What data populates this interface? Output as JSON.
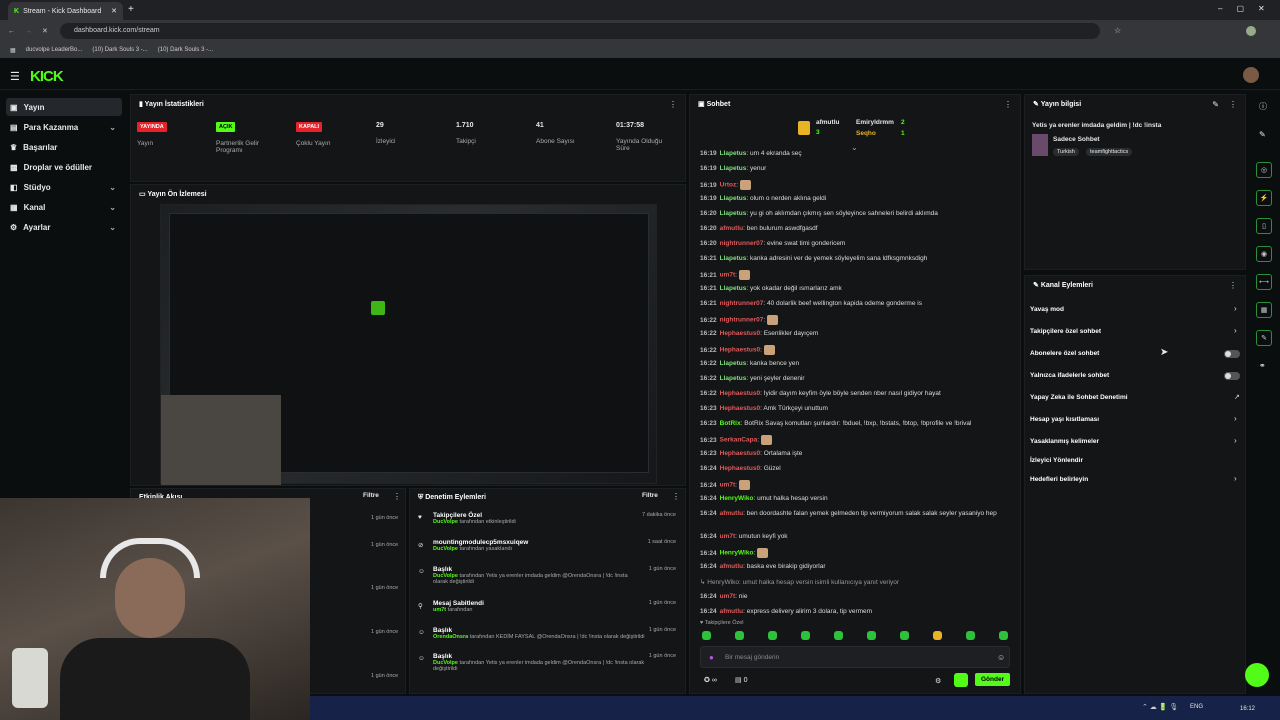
{
  "browser": {
    "tab_title": "Stream - Kick Dashboard",
    "url": "dashboard.kick.com/stream",
    "bookmarks": [
      "ducvolpe LeaderBo...",
      "(10) Dark Souls 3 -...",
      "(10) Dark Souls 3 -..."
    ]
  },
  "logo": "KICK",
  "sidebar": {
    "items": [
      {
        "label": "Yayın",
        "icon": "play-icon"
      },
      {
        "label": "Para Kazanma",
        "icon": "money-icon"
      },
      {
        "label": "Başarılar",
        "icon": "trophy-icon"
      },
      {
        "label": "Droplar ve ödüller",
        "icon": "gift-icon"
      },
      {
        "label": "Stüdyo",
        "icon": "studio-icon"
      },
      {
        "label": "Kanal",
        "icon": "channel-icon"
      },
      {
        "label": "Ayarlar",
        "icon": "gear-icon"
      }
    ]
  },
  "stats": {
    "title": "Yayın İstatistikleri",
    "items": [
      {
        "value": "YAYINDA",
        "label": "Yayın"
      },
      {
        "value": "AÇIK",
        "label": "Partnerlik Gelir Programı"
      },
      {
        "value": "KAPALI",
        "label": "Çoklu Yayın"
      },
      {
        "value": "29",
        "label": "İzleyici"
      },
      {
        "value": "1.710",
        "label": "Takipçi"
      },
      {
        "value": "41",
        "label": "Abone Sayısı"
      },
      {
        "value": "01:37:58",
        "label": "Yayında Olduğu Süre"
      }
    ]
  },
  "preview": {
    "title": "Yayın Ön İzlemesi"
  },
  "activity": {
    "title": "Etkinlik Akışı",
    "filter": "Filtre",
    "times": [
      "1 gün önce",
      "1 gün önce",
      "1 gün önce",
      "1 gün önce",
      "1 gün önce"
    ]
  },
  "moderation": {
    "title": "Denetim Eylemleri",
    "filter": "Filtre",
    "items": [
      {
        "title": "Takipçilere Özel",
        "by": "DucVolpe",
        "sub": "tarafından etkinleştirildi",
        "time": "7 dakika önce"
      },
      {
        "title": "mountingmodulecp5msxuiqew",
        "by": "DucVolpe",
        "sub": "tarafından yasaklandı",
        "time": "1 saat önce"
      },
      {
        "title": "Başlık",
        "by": "DucVolpe",
        "sub": "tarafından Yetis ya erenler imdada geldim @OrendaOnsra | !dc !insta olarak değiştirildi",
        "time": "1 gün önce"
      },
      {
        "title": "Mesaj Sabitlendi",
        "by": "um7t",
        "sub": "tarafından",
        "time": "1 gün önce"
      },
      {
        "title": "Başlık",
        "by": "OrendaOnsra",
        "sub": "tarafından KEDİM FAYSAL @OrendaOnsra | !dc !insta olarak değiştirildi",
        "time": "1 gün önce"
      },
      {
        "title": "Başlık",
        "by": "DucVolpe",
        "sub": "tarafından Yetis ya erenler imdada geldim @OrendaOnsra | !dc !insta olarak değiştirildi",
        "time": "1 gün önce"
      }
    ]
  },
  "chat": {
    "title": "Sohbet",
    "top_gifters": [
      {
        "name": "afmutlu",
        "count": "3"
      },
      {
        "name": "Emiryldrmm",
        "count": "2"
      },
      {
        "name": "Seqho",
        "count": "1"
      }
    ],
    "messages": [
      {
        "time": "16:19",
        "user": "Llapetus",
        "color": "#7fe07f",
        "text": "um 4 ekranda seç"
      },
      {
        "time": "16:19",
        "user": "Llapetus",
        "color": "#7fe07f",
        "text": "yenur"
      },
      {
        "time": "16:19",
        "user": "Urtoz",
        "color": "#e05a5a",
        "text": ""
      },
      {
        "time": "16:19",
        "user": "Llapetus",
        "color": "#7fe07f",
        "text": "olum o nerden aklına geldi"
      },
      {
        "time": "16:20",
        "user": "Llapetus",
        "color": "#7fe07f",
        "text": "yu gi oh aklımdan çıkmış sen söyleyince sahneleri belirdi aklımda"
      },
      {
        "time": "16:20",
        "user": "afmutlu",
        "color": "#e05a5a",
        "text": "ben bulurum aswdfgasdf"
      },
      {
        "time": "16:20",
        "user": "nightrunner07",
        "color": "#e05a5a",
        "text": "evine swat timi gondericem"
      },
      {
        "time": "16:21",
        "user": "Llapetus",
        "color": "#7fe07f",
        "text": "kanka adresini ver de yemek söyleyelim sana ldfksgmnksdigh"
      },
      {
        "time": "16:21",
        "user": "um7t",
        "color": "#e05a5a",
        "text": ""
      },
      {
        "time": "16:21",
        "user": "Llapetus",
        "color": "#7fe07f",
        "text": "yok okadar değil ısmarlarız amk"
      },
      {
        "time": "16:21",
        "user": "nightrunner07",
        "color": "#e05a5a",
        "text": "40 dolarlik beef wellington kapida odeme gonderme is"
      },
      {
        "time": "16:22",
        "user": "nightrunner07",
        "color": "#e05a5a",
        "text": ""
      },
      {
        "time": "16:22",
        "user": "Hephaestus0",
        "color": "#e05a5a",
        "text": "Esenlikler dayıçem"
      },
      {
        "time": "16:22",
        "user": "Hephaestus0",
        "color": "#e05a5a",
        "text": ""
      },
      {
        "time": "16:22",
        "user": "Llapetus",
        "color": "#7fe07f",
        "text": "kanka bence yen"
      },
      {
        "time": "16:22",
        "user": "Llapetus",
        "color": "#7fe07f",
        "text": "yeni şeyler denenir"
      },
      {
        "time": "16:22",
        "user": "Hephaestus0",
        "color": "#e05a5a",
        "text": "İyidir dayım keyfim öyle böyle senden nber nasıl gidiyor hayat"
      },
      {
        "time": "16:23",
        "user": "Hephaestus0",
        "color": "#e05a5a",
        "text": "Amk Türkçeyi unuttum"
      },
      {
        "time": "16:23",
        "user": "BotRix",
        "color": "#53fc18",
        "text": "BotRix Savaş komutları şunlardır: !bduel, !bxp, !bstats, !btop, !bprofile ve !brival"
      },
      {
        "time": "16:23",
        "user": "SerkanCapa",
        "color": "#e05a5a",
        "text": ""
      },
      {
        "time": "16:23",
        "user": "Hephaestus0",
        "color": "#e05a5a",
        "text": "Ortalama işte"
      },
      {
        "time": "16:24",
        "user": "Hephaestus0",
        "color": "#e05a5a",
        "text": "Güzel"
      },
      {
        "time": "16:24",
        "user": "um7t",
        "color": "#e05a5a",
        "text": ""
      },
      {
        "time": "16:24",
        "user": "HenryWiko",
        "color": "#53fc18",
        "text": "umut halka hesap versin"
      },
      {
        "time": "16:24",
        "user": "afmutlu",
        "color": "#e05a5a",
        "text": "ben doordashte falan yemek gelmeden tip vermiyorum salak salak seyler yasaniyo hep"
      },
      {
        "time": "16:24",
        "user": "um7t",
        "color": "#e05a5a",
        "text": "umutun keyfi yok"
      },
      {
        "time": "16:24",
        "user": "HenryWiko",
        "color": "#53fc18",
        "text": ""
      },
      {
        "time": "16:24",
        "user": "afmutlu",
        "color": "#e05a5a",
        "text": "baska eve birakip gidiyorlar"
      },
      {
        "time": "",
        "user": "",
        "color": "#999",
        "text": "↳ HenryWiko: umut halka hesap versin isimli kullanıcıya yanıt veriyor"
      },
      {
        "time": "16:24",
        "user": "um7t",
        "color": "#e05a5a",
        "text": "nie"
      },
      {
        "time": "16:24",
        "user": "afmutlu",
        "color": "#e05a5a",
        "text": "express delivery alirim 3 dolara, tip vermem"
      }
    ],
    "mode_label": "Takipçilere Özel",
    "input_placeholder": "Bir mesaj gönderin",
    "send_label": "Gönder",
    "viewers_count": "0",
    "infinity": "∞"
  },
  "stream_info": {
    "title": "Yayın bilgisi",
    "stream_title": "Yetis ya erenler imdada geldim | !dc !insta",
    "category": "Sadece Sohbet",
    "tags": [
      "Turkish",
      "teamfighttactics"
    ]
  },
  "channel_actions": {
    "title": "Kanal Eylemleri",
    "items": [
      {
        "label": "Yavaş mod",
        "control": "arrow"
      },
      {
        "label": "Takipçilere özel sohbet",
        "control": "arrow"
      },
      {
        "label": "Abonelere özel sohbet",
        "control": "toggle"
      },
      {
        "label": "Yalnızca ifadelerle sohbet",
        "control": "toggle"
      },
      {
        "label": "Yapay Zeka ile Sohbet Denetimi",
        "control": "external"
      },
      {
        "label": "Hesap yaşı kısıtlaması",
        "control": "arrow"
      },
      {
        "label": "Yasaklanmış kelimeler",
        "control": "arrow"
      },
      {
        "label": "İzleyici Yönlendir",
        "control": "none"
      },
      {
        "label": "Hedefleri belirleyin",
        "control": "arrow"
      }
    ]
  },
  "taskbar": {
    "lang": "ENG",
    "time": "16:12"
  }
}
